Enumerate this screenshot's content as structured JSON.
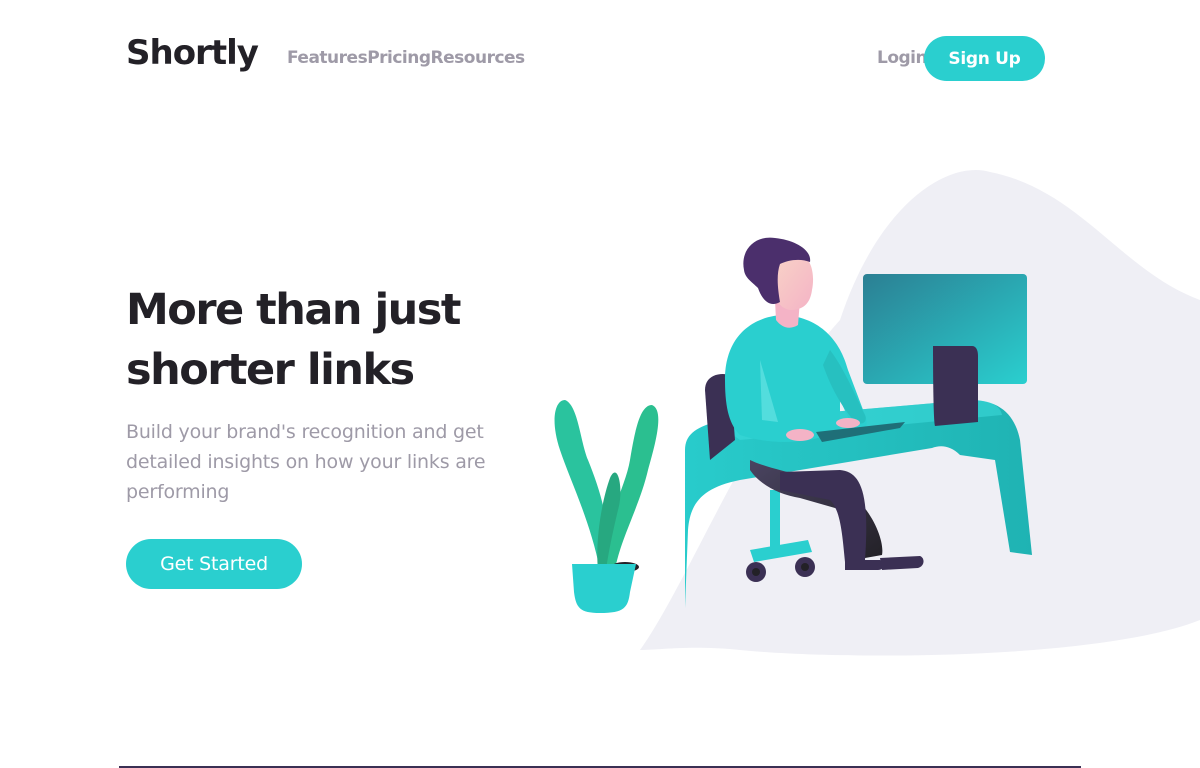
{
  "header": {
    "logo": "Shortly",
    "nav": [
      "Features",
      "Pricing",
      "Resources"
    ],
    "login_label": "Login",
    "signup_label": "Sign Up"
  },
  "hero": {
    "title": "More than just shorter links",
    "subtitle": "Build your brand's recognition and get detailed insights on how your links are performing",
    "cta_label": "Get Started"
  },
  "colors": {
    "primary": "#2acfcf",
    "dark_violet": "#3b3054",
    "grayish_violet": "#9e9aa7",
    "very_dark": "#232127",
    "blob": "#efeff5"
  },
  "illustration": {
    "icon": "person-working-at-desk-illustration"
  }
}
